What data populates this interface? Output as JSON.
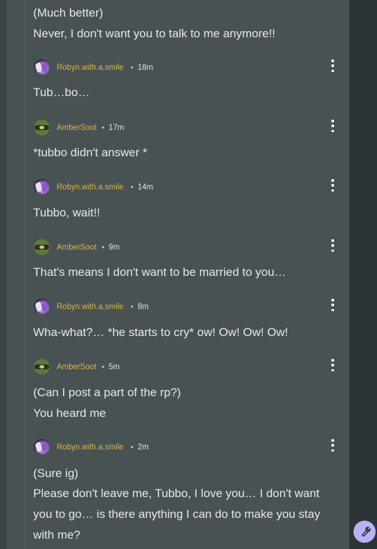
{
  "thread": {
    "top_lines": [
      "(Much better)",
      "Never, I don't want you to talk to me anymore!!"
    ],
    "replies": [
      {
        "avatar": "robyn-avatar",
        "username": "Robyn.with.a.smile",
        "separator": "•",
        "time": "18m",
        "lines": [
          "Tub…bo…"
        ]
      },
      {
        "avatar": "amber-avatar",
        "username": "AmberSoot",
        "separator": "•",
        "time": "17m",
        "lines": [
          "*tubbo didn't answer *"
        ]
      },
      {
        "avatar": "robyn-avatar",
        "username": "Robyn.with.a.smile",
        "separator": "•",
        "time": "14m",
        "lines": [
          "Tubbo, wait!!"
        ]
      },
      {
        "avatar": "amber-avatar",
        "username": "AmberSoot",
        "separator": "•",
        "time": "9m",
        "lines": [
          "That's means I don't want to be married to you…"
        ]
      },
      {
        "avatar": "robyn-avatar",
        "username": "Robyn.with.a.smile",
        "separator": "•",
        "time": "8m",
        "lines": [
          "Wha-what?… *he starts to cry* ow! Ow! Ow! Ow!"
        ]
      },
      {
        "avatar": "amber-avatar",
        "username": "AmberSoot",
        "separator": "•",
        "time": "5m",
        "lines": [
          "(Can I post a part of the rp?)",
          "You heard me"
        ]
      },
      {
        "avatar": "robyn-avatar",
        "username": "Robyn.with.a.smile",
        "separator": "•",
        "time": "2m",
        "lines": [
          "(Sure ig)",
          "Please don't leave me, Tubbo, I love you… I don't want",
          "you to go… is there anything I can do to make you stay",
          "with me?"
        ]
      }
    ]
  },
  "icons": {
    "more": "more-vertical-icon",
    "fab": "wrench-icon"
  },
  "colors": {
    "panel": "#485253",
    "background": "#2d3536",
    "username": "#d9b54a",
    "text": "#e6eaea",
    "fab": "#b8b2f4"
  }
}
